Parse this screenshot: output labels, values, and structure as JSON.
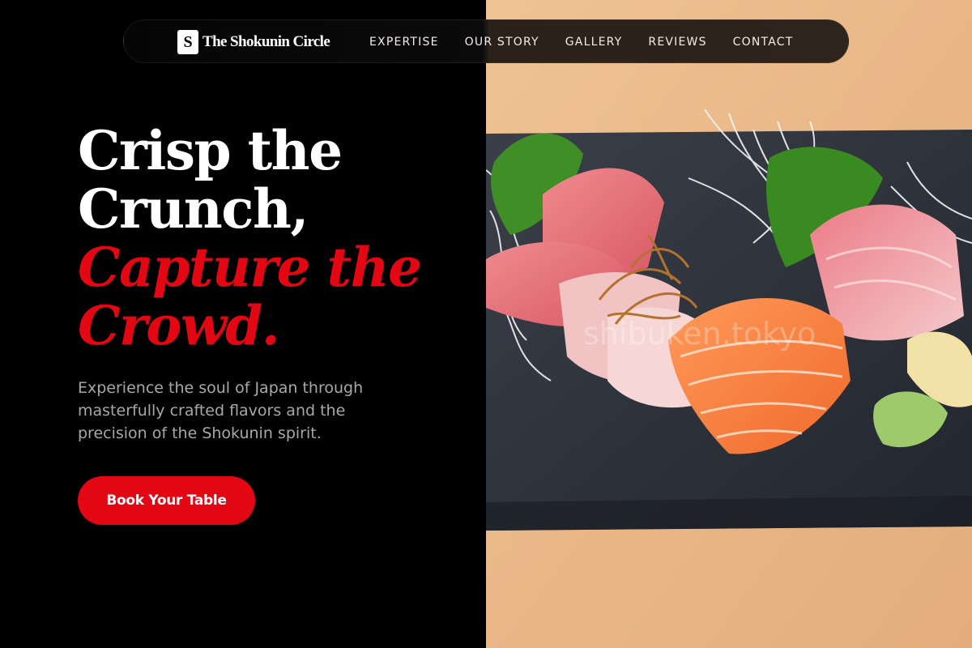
{
  "brand": {
    "logo_letter": "S",
    "name": "The Shokunin Circle"
  },
  "nav": {
    "items": [
      {
        "label": "EXPERTISE"
      },
      {
        "label": "OUR STORY"
      },
      {
        "label": "GALLERY"
      },
      {
        "label": "REVIEWS"
      },
      {
        "label": "CONTACT"
      }
    ]
  },
  "hero": {
    "title_line1": "Crisp the",
    "title_line2": "Crunch,",
    "title_line3": "Capture the",
    "title_line4": "Crowd.",
    "subtitle": "Experience the soul of Japan through masterfully crafted flavors and the precision of the Shokunin spirit.",
    "cta_label": "Book Your Table"
  },
  "image": {
    "subject": "sashimi-platter-photo",
    "watermark": "shibuken.tokyo"
  },
  "colors": {
    "accent": "#e30613",
    "background": "#000000",
    "text_primary": "#ffffff",
    "text_secondary": "#a8a8a8"
  }
}
